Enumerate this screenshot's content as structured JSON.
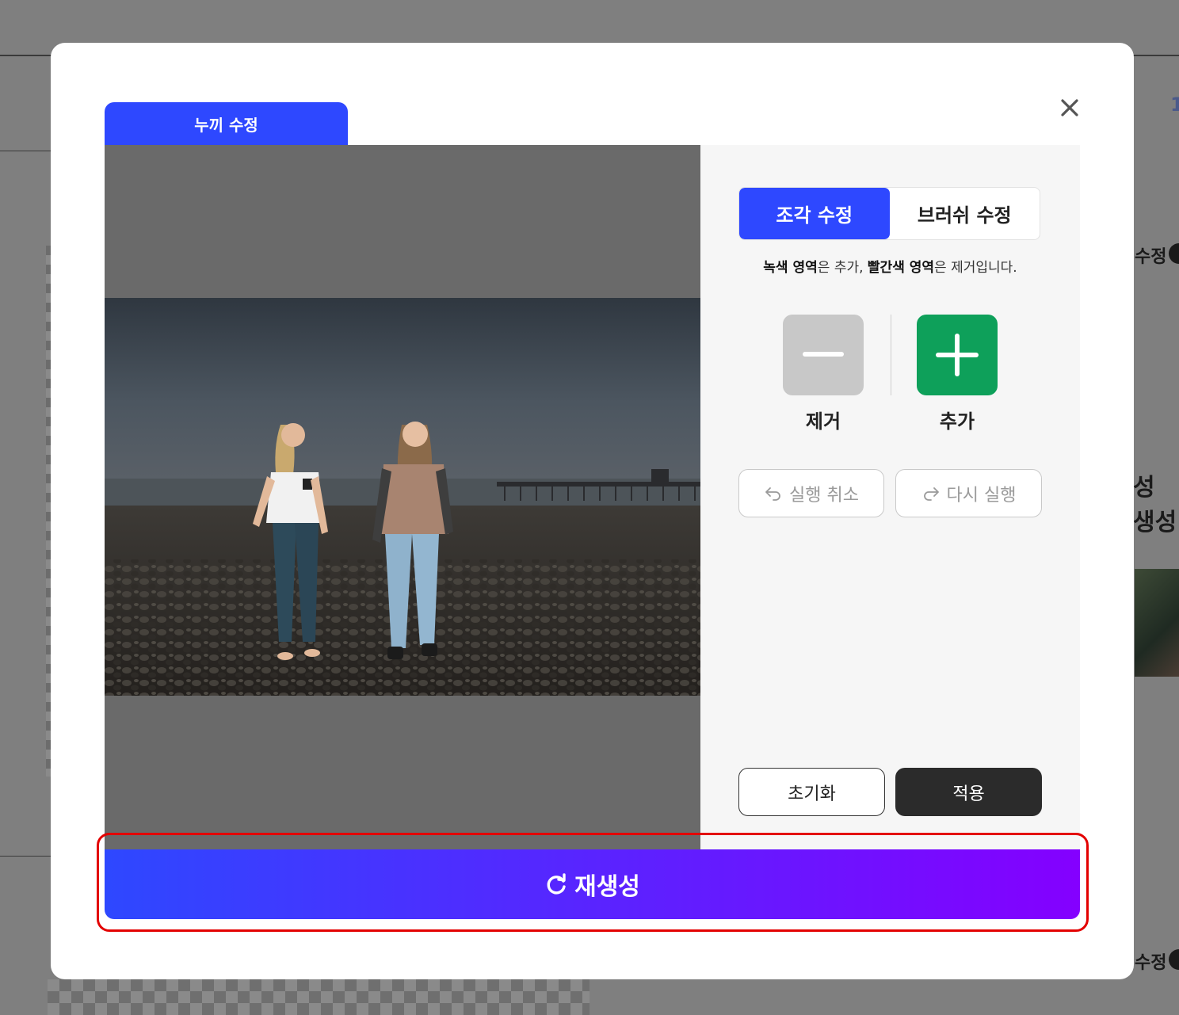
{
  "background": {
    "right_label_1": "수정",
    "right_label_2": "성 생성",
    "right_label_3": "수정",
    "right_digit": "1"
  },
  "modal": {
    "tab_title": "누끼 수정",
    "close_icon": "close-icon",
    "mode_tabs": [
      {
        "label": "조각 수정",
        "active": true
      },
      {
        "label": "브러쉬 수정",
        "active": false
      }
    ],
    "hint": {
      "green": "녹색 영역",
      "mid": "은 추가, ",
      "red": "빨간색 영역",
      "end": "은 제거입니다."
    },
    "tools": {
      "remove_label": "제거",
      "add_label": "추가",
      "remove_icon": "minus-icon",
      "add_icon": "plus-icon"
    },
    "undo_label": "실행 취소",
    "redo_label": "다시 실행",
    "reset_label": "초기화",
    "apply_label": "적용",
    "regenerate_label": "재생성"
  },
  "colors": {
    "accent": "#2e48ff",
    "add_green": "#0ea05a",
    "regen_gradient_end": "#8400ff",
    "highlight_red": "#e30000"
  }
}
